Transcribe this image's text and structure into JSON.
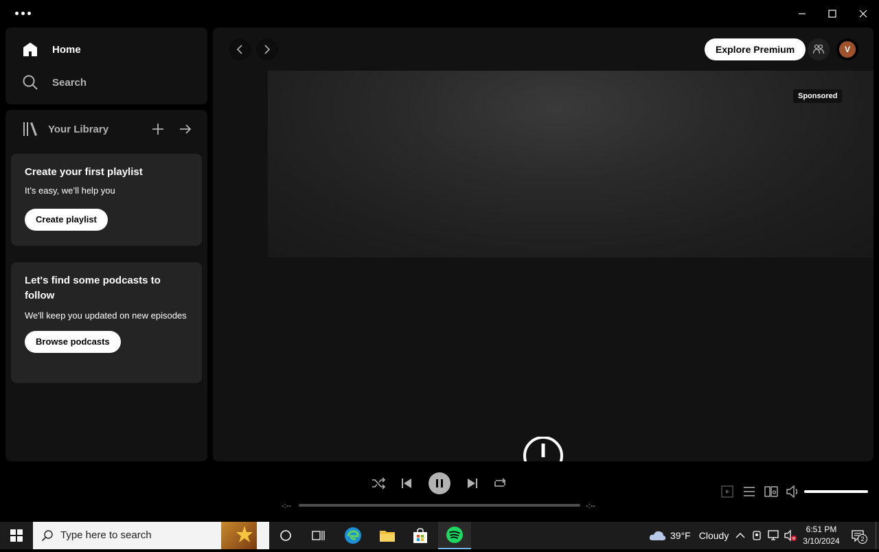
{
  "window": {
    "menu_icon": "more-horizontal-icon",
    "controls": [
      "minimize-icon",
      "maximize-icon",
      "close-icon"
    ]
  },
  "nav": {
    "home_label": "Home",
    "search_label": "Search"
  },
  "library": {
    "title": "Your Library",
    "cards": [
      {
        "title": "Create your first playlist",
        "subtitle": "It’s easy, we’ll help you",
        "button": "Create playlist"
      },
      {
        "title": "Let's find some podcasts to follow",
        "subtitle": "We'll keep you updated on new episodes",
        "button": "Browse podcasts"
      }
    ]
  },
  "header": {
    "explore_premium": "Explore Premium",
    "avatar_initial": "V"
  },
  "banner": {
    "sponsored_label": "Sponsored"
  },
  "player": {
    "elapsed": "-:--",
    "duration": "-:--",
    "progress": 0,
    "volume": 1.0
  },
  "taskbar": {
    "search_placeholder": "Type here to search",
    "weather_temp": "39°F",
    "weather_text": "Cloudy",
    "time": "6:51 PM",
    "date": "3/10/2024",
    "notification_count": "2"
  },
  "colors": {
    "spotify_green": "#1ed760",
    "panel": "#121212",
    "card": "#242424",
    "avatar": "#a0522d"
  }
}
